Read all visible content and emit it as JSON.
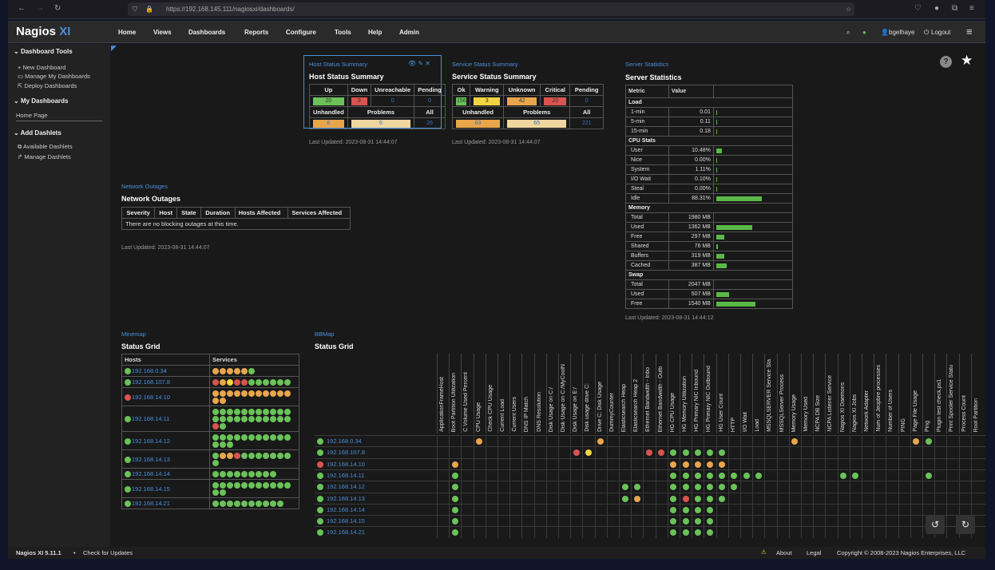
{
  "browser": {
    "url": "https://192.168.145.111/nagiosxi/dashboards/"
  },
  "nav": {
    "logo_main": "Nagios",
    "logo_xi": "XI",
    "items": [
      "Home",
      "Views",
      "Dashboards",
      "Reports",
      "Configure",
      "Tools",
      "Help",
      "Admin"
    ],
    "user": "bgelhaye",
    "logout": "Logout"
  },
  "sidebar": {
    "dashboard_tools": "Dashboard Tools",
    "new_dashboard": "New Dashboard",
    "manage_my_dashboards": "Manage My Dashboards",
    "deploy_dashboards": "Deploy Dashboards",
    "my_dashboards": "My Dashboards",
    "home_page": "Home Page",
    "add_dashlets": "Add Dashlets",
    "available_dashlets": "Available Dashlets",
    "manage_dashlets": "Manage Dashlets"
  },
  "host_status": {
    "link": "Host Status Summary",
    "title": "Host Status Summary",
    "headers": [
      "Up",
      "Down",
      "Unreachable",
      "Pending"
    ],
    "values": [
      "20",
      "9",
      "0",
      "0"
    ],
    "headers2": [
      "Unhandled",
      "Problems",
      "All"
    ],
    "values2": [
      "6",
      "6",
      "26"
    ],
    "updated": "Last Updated: 2023-08-31 14:44:07"
  },
  "service_status": {
    "link": "Service Status Summary",
    "title": "Service Status Summary",
    "headers": [
      "Ok",
      "Warning",
      "Unknown",
      "Critical",
      "Pending"
    ],
    "values": [
      "156",
      "3",
      "42",
      "20",
      "0"
    ],
    "headers2": [
      "Unhandled",
      "Problems",
      "All"
    ],
    "values2": [
      "63",
      "65",
      "221"
    ],
    "updated": "Last Updated: 2023-08-31 14:44:07"
  },
  "server_stats": {
    "link": "Server Statistics",
    "title": "Server Statistics",
    "headers": [
      "Metric",
      "Value"
    ],
    "sections": [
      {
        "name": "Load",
        "rows": [
          {
            "label": "1-min",
            "value": "0.01",
            "pct": 0
          },
          {
            "label": "5-min",
            "value": "0.11",
            "pct": 0
          },
          {
            "label": "15-min",
            "value": "0.18",
            "pct": 0
          }
        ]
      },
      {
        "name": "CPU Stats",
        "rows": [
          {
            "label": "User",
            "value": "10.48%",
            "pct": 10.48
          },
          {
            "label": "Nice",
            "value": "0.00%",
            "pct": 0
          },
          {
            "label": "System",
            "value": "1.11%",
            "pct": 1.11
          },
          {
            "label": "I/O Wait",
            "value": "0.10%",
            "pct": 0.1
          },
          {
            "label": "Steal",
            "value": "0.00%",
            "pct": 0
          },
          {
            "label": "Idle",
            "value": "88.31%",
            "pct": 88.31
          }
        ]
      },
      {
        "name": "Memory",
        "rows": [
          {
            "label": "Total",
            "value": "1980 MB",
            "pct": 0
          },
          {
            "label": "Used",
            "value": "1362 MB",
            "pct": 68.8
          },
          {
            "label": "Free",
            "value": "297 MB",
            "pct": 15
          },
          {
            "label": "Shared",
            "value": "76 MB",
            "pct": 3.8
          },
          {
            "label": "Buffers",
            "value": "319 MB",
            "pct": 16.1
          },
          {
            "label": "Cached",
            "value": "387 MB",
            "pct": 19.5
          }
        ]
      },
      {
        "name": "Swap",
        "rows": [
          {
            "label": "Total",
            "value": "2047 MB",
            "pct": 0
          },
          {
            "label": "Used",
            "value": "507 MB",
            "pct": 24.8
          },
          {
            "label": "Free",
            "value": "1540 MB",
            "pct": 75.2
          }
        ]
      }
    ],
    "updated": "Last Updated: 2023-08-31 14:44:12"
  },
  "outages": {
    "link": "Network Outages",
    "title": "Network Outages",
    "headers": [
      "Severity",
      "Host",
      "State",
      "Duration",
      "Hosts Affected",
      "Services Affected"
    ],
    "message": "There are no blocking outages at this time.",
    "updated": "Last Updated: 2023-08-31 14:44:07"
  },
  "minemap": {
    "link": "Minemap",
    "title": "Status Grid",
    "headers": [
      "Hosts",
      "Services"
    ],
    "rows": [
      {
        "host": "192.168.0.34",
        "status": "g",
        "services": "ooooog"
      },
      {
        "host": "192.168.107.8",
        "status": "g",
        "services": "royrrgggggg"
      },
      {
        "host": "192.168.14.10",
        "status": "r",
        "services": "ooooooooooooo"
      },
      {
        "host": "192.168.14.11",
        "status": "g",
        "services": "ggggggggggggggggggggggrg"
      },
      {
        "host": "192.168.14.12",
        "status": "g",
        "services": "gggggggggggggg"
      },
      {
        "host": "192.168.14.13",
        "status": "g",
        "services": "goorgggggggg"
      },
      {
        "host": "192.168.14.14",
        "status": "g",
        "services": "ggggggggg"
      },
      {
        "host": "192.168.14.15",
        "status": "g",
        "services": "ggggggggggggg"
      },
      {
        "host": "192.168.14.21",
        "status": "g",
        "services": "gggggggggg"
      }
    ]
  },
  "bbmap": {
    "link": "BBMap",
    "title": "Status Grid",
    "columns": [
      "ApplicationFrameHost",
      "Boot Partition Utilization",
      "C Volume Used Percent",
      "CPU Usage",
      "Check CPU Usage",
      "Current Load",
      "Current Users",
      "DNS IP Match",
      "DNS Resolution",
      "Disk Usage on C:/",
      "Disk Usage on C:/MyCoolN",
      "Disk Usage on E:/",
      "Disk usage drive C:",
      "Drive C: Disk Usage",
      "DummyCounter",
      "Elasticsearch Heap",
      "Elasticsearch Heap 2",
      "Ethernet Bandwidth - Inbo",
      "Ethernet Bandwidth - Outb",
      "HG CPU Usage",
      "HG Memory Utilization",
      "HG Primary NIC Inbound",
      "HG Primary NIC Outbound",
      "HG User Count",
      "HTTP",
      "I/O Wait",
      "Load",
      "MSSQLSERVER Service Sta",
      "MSSQLServer Process",
      "Memory Usage",
      "Memory Used",
      "NCPA DB Size",
      "NCPA Listener Service",
      "Nagios XI Daemons",
      "Nagios XI Jobs",
      "Network Adapter",
      "Num of Jeopbre processes",
      "Number of Users",
      "PING",
      "Page File Usage",
      "Ping",
      "Plugin test check.ps1",
      "Print Spooler Service Statu",
      "Process Count",
      "Root Partition"
    ],
    "rows": [
      {
        "host": "192.168.0.34",
        "status": "g",
        "cells": {
          "3": "o",
          "13": "o",
          "29": "o",
          "39": "o",
          "40": "g"
        }
      },
      {
        "host": "192.168.107.8",
        "status": "g",
        "cells": {
          "11": "r",
          "12": "y",
          "17": "r",
          "18": "r",
          "19": "g",
          "20": "g",
          "21": "g",
          "22": "g",
          "23": "g"
        }
      },
      {
        "host": "192.168.14.10",
        "status": "r",
        "cells": {
          "1": "o",
          "19": "o",
          "20": "o",
          "21": "o",
          "22": "o",
          "23": "o"
        }
      },
      {
        "host": "192.168.14.11",
        "status": "g",
        "cells": {
          "1": "g",
          "19": "g",
          "20": "g",
          "21": "g",
          "22": "g",
          "23": "g",
          "24": "g",
          "25": "g",
          "26": "g",
          "33": "g",
          "34": "g",
          "40": "g"
        }
      },
      {
        "host": "192.168.14.12",
        "status": "g",
        "cells": {
          "1": "g",
          "15": "g",
          "16": "g",
          "19": "g",
          "20": "g",
          "21": "g",
          "22": "g",
          "23": "g",
          "24": "g"
        }
      },
      {
        "host": "192.168.14.13",
        "status": "g",
        "cells": {
          "1": "g",
          "15": "g",
          "16": "o",
          "19": "g",
          "20": "r",
          "21": "g",
          "22": "g",
          "23": "g"
        }
      },
      {
        "host": "192.168.14.14",
        "status": "g",
        "cells": {
          "1": "g",
          "19": "g",
          "20": "g",
          "21": "g",
          "22": "g"
        }
      },
      {
        "host": "192.168.14.15",
        "status": "g",
        "cells": {
          "1": "g",
          "19": "g",
          "20": "g",
          "21": "g",
          "22": "g"
        }
      },
      {
        "host": "192.168.14.21",
        "status": "g",
        "cells": {
          "1": "g",
          "19": "g",
          "20": "g",
          "21": "g",
          "22": "g"
        }
      }
    ]
  },
  "footer": {
    "version": "Nagios XI 5.11.1",
    "check_updates": "Check for Updates",
    "about": "About",
    "legal": "Legal",
    "copyright": "Copyright © 2008-2023 Nagios Enterprises, LLC"
  },
  "colors": {
    "accent": "#4a90d9",
    "ok": "#6ac259",
    "warning": "#f0d540",
    "critical": "#d9534f",
    "unknown": "#e8a54b"
  }
}
